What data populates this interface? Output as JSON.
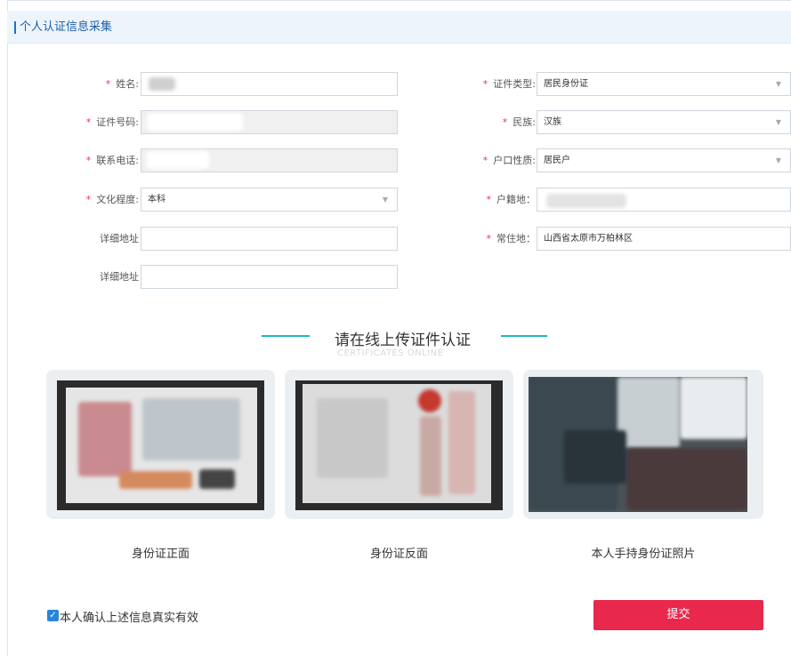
{
  "header": {
    "title": "个人认证信息采集"
  },
  "form": {
    "left": [
      {
        "label": "姓名:",
        "required": true,
        "value": "",
        "type": "text"
      },
      {
        "label": "证件号码:",
        "required": true,
        "value": "",
        "type": "text",
        "disabled": true
      },
      {
        "label": "联系电话:",
        "required": true,
        "value": "",
        "type": "text",
        "disabled": true
      },
      {
        "label": "文化程度:",
        "required": true,
        "value": "本科",
        "type": "select"
      },
      {
        "label": "详细地址",
        "required": false,
        "value": "",
        "type": "text"
      },
      {
        "label": "详细地址",
        "required": false,
        "value": "",
        "type": "text"
      }
    ],
    "right": [
      {
        "label": "证件类型:",
        "required": true,
        "value": "居民身份证",
        "type": "select"
      },
      {
        "label": "民族:",
        "required": true,
        "value": "汉族",
        "type": "select"
      },
      {
        "label": "户口性质:",
        "required": true,
        "value": "居民户",
        "type": "select"
      },
      {
        "label": "户籍地：",
        "required": true,
        "value": "",
        "type": "text"
      },
      {
        "label": "常住地：",
        "required": true,
        "value": "山西省太原市万柏林区",
        "type": "text"
      }
    ],
    "required_mark": "*",
    "select_arrow": "▼"
  },
  "upload": {
    "title": "请在线上传证件认证",
    "subtitle": "CERTIFICATES ONLINE",
    "accent_color": "#1bb8c4",
    "cards": [
      {
        "caption": "身份证正面",
        "image": "id-card-front-photo"
      },
      {
        "caption": "身份证反面",
        "image": "id-card-back-photo"
      },
      {
        "caption": "本人手持身份证照片",
        "image": "holding-id-photo"
      }
    ]
  },
  "footer": {
    "confirm_label": "本人确认上述信息真实有效",
    "confirm_checked": true,
    "check_glyph": "✓",
    "submit_label": "提交",
    "submit_color": "#e8294d"
  }
}
